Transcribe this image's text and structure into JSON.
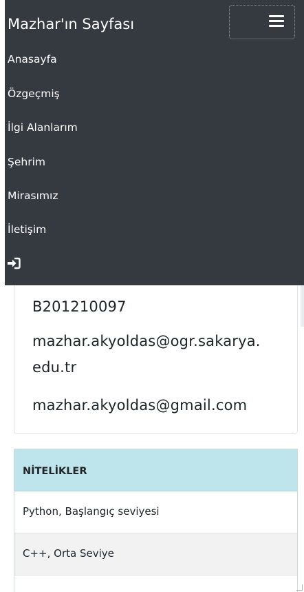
{
  "navbar": {
    "brand": "Mazhar'ın Sayfası",
    "toggler_icon": "hamburger-menu-icon",
    "items": [
      {
        "label": "Anasayfa"
      },
      {
        "label": "Özgeçmiş"
      },
      {
        "label": "İlgi Alanlarım"
      },
      {
        "label": "Şehrim"
      },
      {
        "label": "Mirasımız"
      },
      {
        "label": "İletişim"
      }
    ],
    "login_icon": "sign-in-icon",
    "background_color": "#343a40"
  },
  "contact": {
    "student_no": "B201210097",
    "school_email_line1": "mazhar.akyoldas@ogr.sakarya.",
    "school_email_line2": "edu.tr",
    "personal_email": "mazhar.akyoldas@gmail.com"
  },
  "qualifications": {
    "header": "NİTELİKLER",
    "header_color": "#bee5eb",
    "items": [
      {
        "label": "Python, Başlangıç seviyesi",
        "bg": "#ffffff"
      },
      {
        "label": "C++, Orta Seviye",
        "bg": "#f2f2f2"
      },
      {
        "label": "",
        "bg": "#ffffff"
      }
    ]
  }
}
